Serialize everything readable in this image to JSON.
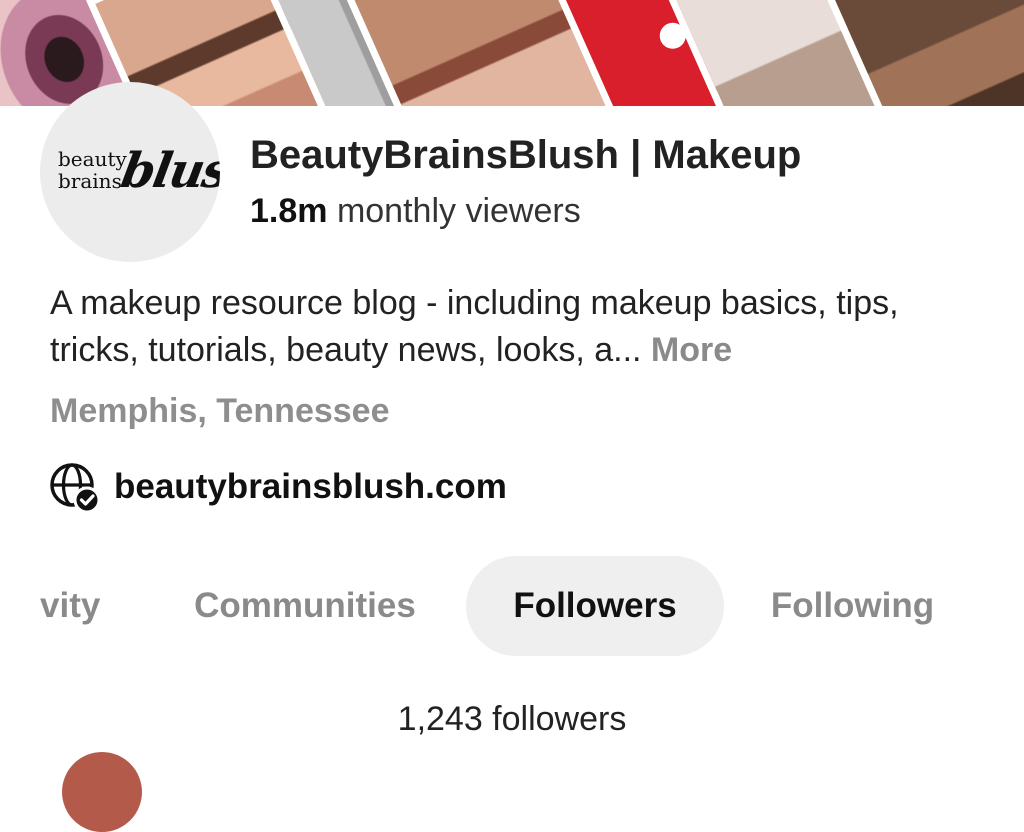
{
  "profile": {
    "name": "BeautyBrainsBlush | Makeup",
    "viewers_count": "1.8m",
    "viewers_label": " monthly viewers",
    "bio": "A makeup resource blog - including makeup basics, tips, tricks, tutorials, beauty news, looks, a... ",
    "bio_more": "More",
    "location": "Memphis, Tennessee",
    "website": "beautybrainsblush.com",
    "logo": {
      "line1": "beauty",
      "line2": "brains",
      "script": "blush"
    }
  },
  "tabs": [
    {
      "label": "vity",
      "active": false
    },
    {
      "label": "Communities",
      "active": false
    },
    {
      "label": "Followers",
      "active": true
    },
    {
      "label": "Following",
      "active": false
    }
  ],
  "followers_count_text": "1,243 followers",
  "icons": {
    "website": "globe-verified-icon"
  },
  "colors": {
    "accent_red": "#d81f2b",
    "muted_text": "#8a8a8a",
    "active_tab_bg": "#efefef"
  }
}
